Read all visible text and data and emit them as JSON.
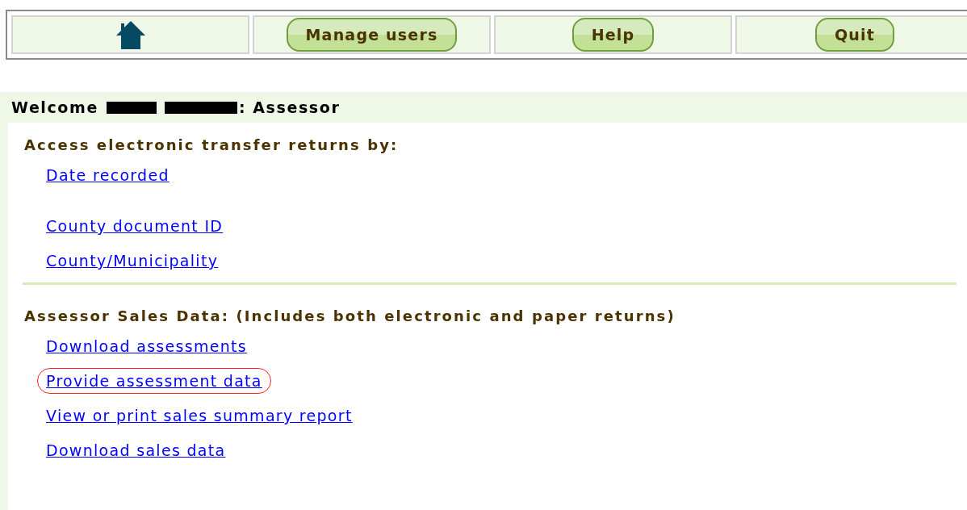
{
  "toolbar": [
    {
      "kind": "home"
    },
    {
      "kind": "button",
      "label": "Manage users"
    },
    {
      "kind": "button",
      "label": "Help"
    },
    {
      "kind": "button",
      "label": "Quit"
    }
  ],
  "welcome": {
    "greeting": "Welcome",
    "role": ": Assessor"
  },
  "sections": [
    {
      "heading": "Access electronic transfer returns by:",
      "links": [
        {
          "label": "Date recorded",
          "highlighted": false
        },
        {
          "label": "County document ID",
          "highlighted": false
        },
        {
          "label": "County/Municipality",
          "highlighted": false
        }
      ]
    },
    {
      "heading": "Assessor Sales Data: (Includes both electronic and paper returns)",
      "links": [
        {
          "label": "Download assessments",
          "highlighted": false
        },
        {
          "label": "Provide assessment data",
          "highlighted": true
        },
        {
          "label": "View or print sales summary report",
          "highlighted": false
        },
        {
          "label": "Download sales data",
          "highlighted": false
        }
      ]
    }
  ]
}
